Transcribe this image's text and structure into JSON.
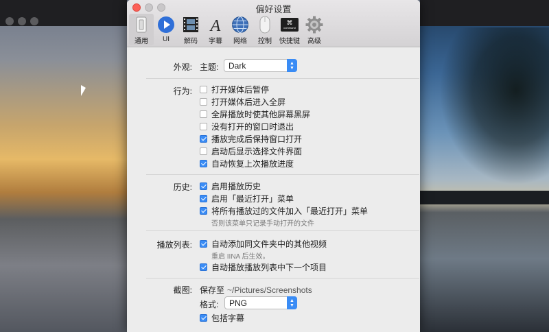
{
  "window": {
    "title": "偏好设置"
  },
  "toolbar": {
    "items": [
      {
        "label": "通用",
        "icon": "switch-icon",
        "active": true
      },
      {
        "label": "UI",
        "icon": "play-circle-icon"
      },
      {
        "label": "解码",
        "icon": "film-icon"
      },
      {
        "label": "字幕",
        "icon": "font-icon"
      },
      {
        "label": "网络",
        "icon": "globe-icon"
      },
      {
        "label": "控制",
        "icon": "mouse-icon"
      },
      {
        "label": "快捷键",
        "icon": "command-key-icon"
      },
      {
        "label": "高级",
        "icon": "gear-icon"
      }
    ],
    "command_key_text": "⌘",
    "command_key_sub": "command"
  },
  "appearance": {
    "label": "外观:",
    "theme_label": "主题:",
    "theme_value": "Dark"
  },
  "behavior": {
    "label": "行为:",
    "options": [
      {
        "label": "打开媒体后暂停",
        "checked": false
      },
      {
        "label": "打开媒体后进入全屏",
        "checked": false
      },
      {
        "label": "全屏播放时使其他屏幕黑屏",
        "checked": false
      },
      {
        "label": "没有打开的窗口时退出",
        "checked": false
      },
      {
        "label": "播放完成后保持窗口打开",
        "checked": true
      },
      {
        "label": "启动后显示选择文件界面",
        "checked": false
      },
      {
        "label": "自动恢复上次播放进度",
        "checked": true
      }
    ]
  },
  "history": {
    "label": "历史:",
    "options": [
      {
        "label": "启用播放历史",
        "checked": true
      },
      {
        "label": "启用「最近打开」菜单",
        "checked": true
      },
      {
        "label": "将所有播放过的文件加入「最近打开」菜单",
        "checked": true
      }
    ],
    "note": "否则该菜单只记录手动打开的文件"
  },
  "playlist": {
    "label": "播放列表:",
    "options": [
      {
        "label": "自动添加同文件夹中的其他视频",
        "checked": true
      },
      {
        "label": "自动播放播放列表中下一个项目",
        "checked": true
      }
    ],
    "note": "重启 IINA 后生效。"
  },
  "screenshot": {
    "label": "截图:",
    "save_to_label": "保存至",
    "save_path": "~/Pictures/Screenshots",
    "format_label": "格式:",
    "format_value": "PNG",
    "include_subtitles": {
      "label": "包括字幕",
      "checked": true
    }
  },
  "colors": {
    "accent": "#3a8cf5",
    "close": "#fc5f57"
  }
}
